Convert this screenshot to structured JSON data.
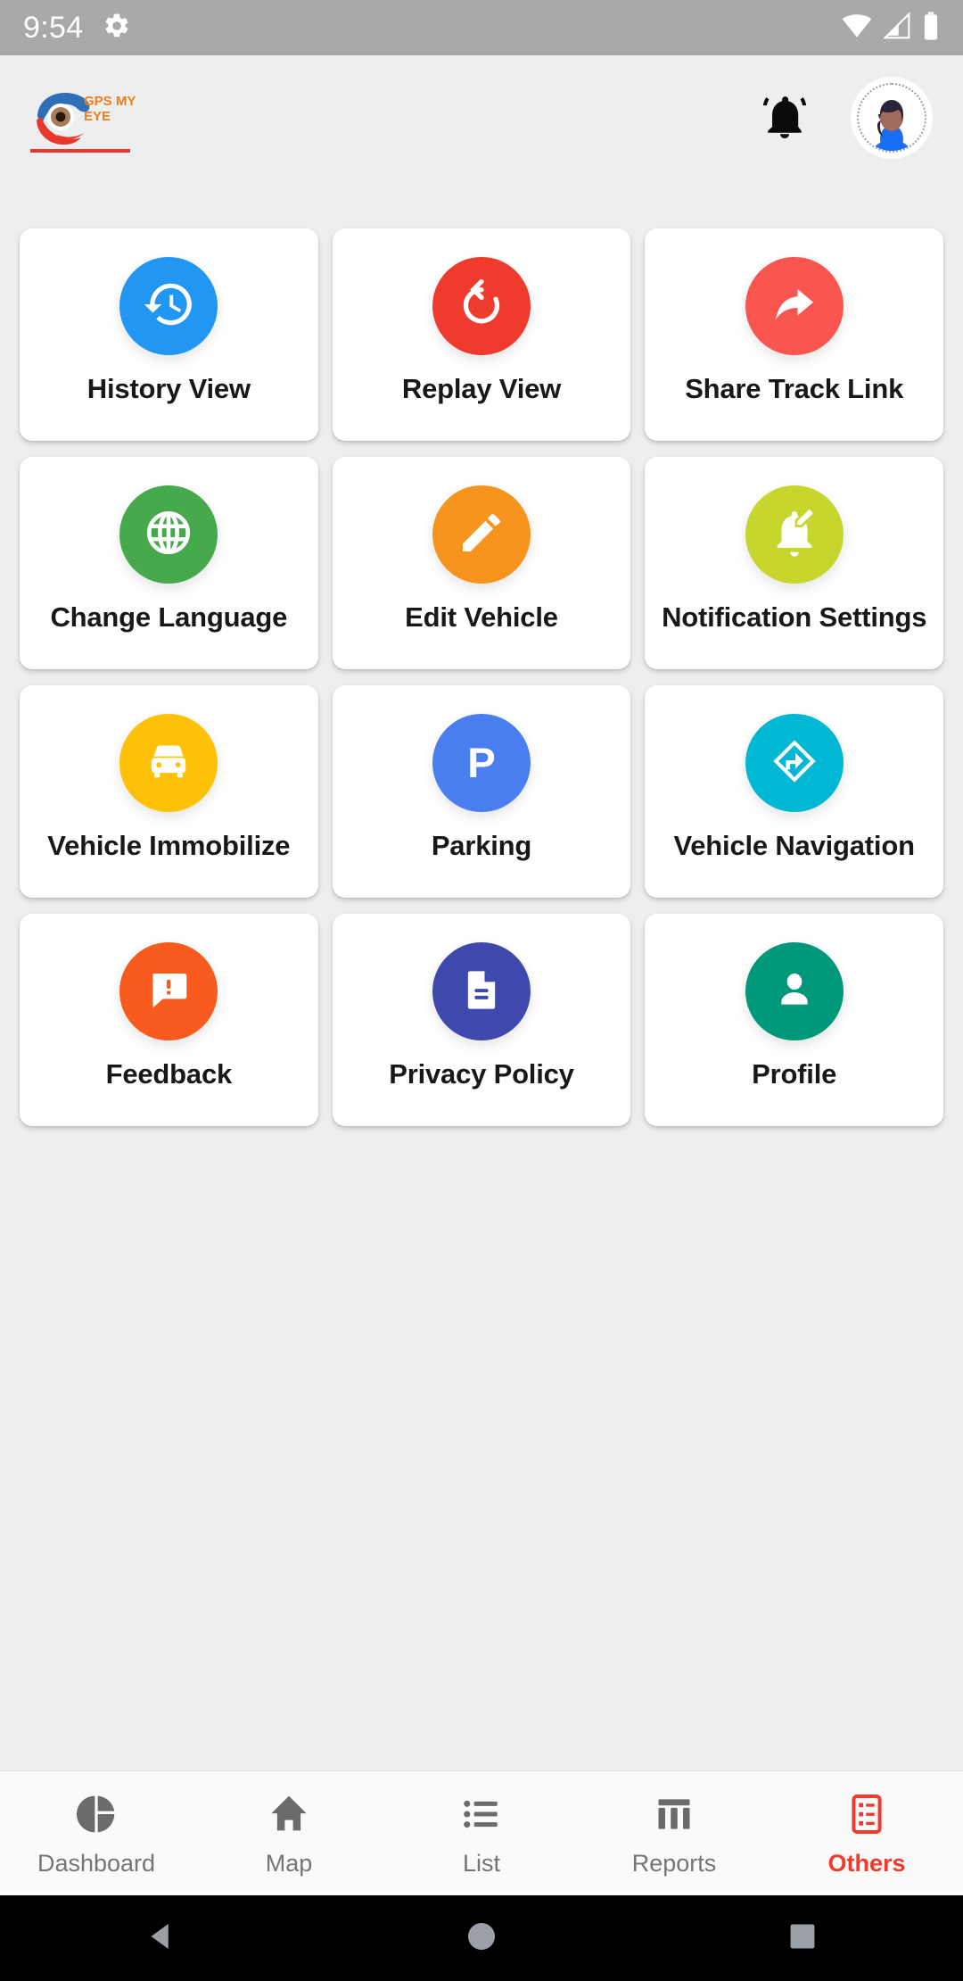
{
  "status_bar": {
    "time": "9:54",
    "icons": [
      "settings-gear-icon",
      "wifi-icon",
      "cellular-signal-icon",
      "battery-icon"
    ]
  },
  "header": {
    "logo_line1": "GPS MY",
    "logo_line2": "EYE",
    "logo_name": "gps-my-eye-logo",
    "notification_icon": "bell-icon",
    "avatar_icon": "user-avatar"
  },
  "colors": {
    "background": "#eceef0",
    "card": "#ffffff",
    "accent": "#f2392c",
    "logo_text": "#f07d1a",
    "status_bar": "#a9a9a9",
    "history": "#2196f3",
    "replay": "#ef3b2e",
    "share": "#f9564f",
    "language": "#46a94b",
    "edit_vehicle": "#f7941d",
    "notification_settings": "#c6d62c",
    "immobilize": "#ffc107",
    "parking": "#4a7ef0",
    "navigation": "#00b8d4",
    "feedback": "#f95a1e",
    "privacy": "#3f48ad",
    "profile": "#00987a"
  },
  "grid": {
    "items": [
      {
        "label": "History View",
        "icon": "history-clock-icon",
        "color": "#2196f3"
      },
      {
        "label": "Replay View",
        "icon": "replay-rotate-icon",
        "color": "#ef3b2e"
      },
      {
        "label": "Share Track Link",
        "icon": "share-arrow-icon",
        "color": "#f9564f"
      },
      {
        "label": "Change Language",
        "icon": "globe-icon",
        "color": "#46a94b"
      },
      {
        "label": "Edit Vehicle",
        "icon": "pencil-edit-icon",
        "color": "#f7941d"
      },
      {
        "label": "Notification Settings",
        "icon": "edit-notifications-icon",
        "color": "#c6d62c"
      },
      {
        "label": "Vehicle Immobilize",
        "icon": "car-front-icon",
        "color": "#ffc107"
      },
      {
        "label": "Parking",
        "icon": "parking-p-icon",
        "color": "#4a7ef0"
      },
      {
        "label": "Vehicle Navigation",
        "icon": "navigation-diamond-icon",
        "color": "#00b8d4"
      },
      {
        "label": "Feedback",
        "icon": "feedback-bubble-icon",
        "color": "#f95a1e"
      },
      {
        "label": "Privacy Policy",
        "icon": "document-icon",
        "color": "#3f48ad"
      },
      {
        "label": "Profile",
        "icon": "person-icon",
        "color": "#00987a"
      }
    ]
  },
  "tabbar": {
    "items": [
      {
        "label": "Dashboard",
        "icon": "pie-chart-icon",
        "active": false
      },
      {
        "label": "Map",
        "icon": "home-pin-icon",
        "active": false
      },
      {
        "label": "List",
        "icon": "list-icon",
        "active": false
      },
      {
        "label": "Reports",
        "icon": "bar-chart-icon",
        "active": false
      },
      {
        "label": "Others",
        "icon": "grid-list-icon",
        "active": true
      }
    ]
  },
  "android_nav": {
    "back": "back-triangle-icon",
    "home": "home-circle-icon",
    "recents": "recents-square-icon"
  }
}
